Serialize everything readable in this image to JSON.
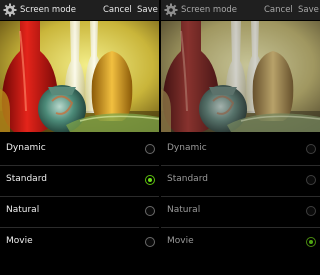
{
  "left": {
    "header": {
      "title": "Screen mode",
      "cancel_label": "Cancel",
      "save_label": "Save"
    },
    "modes": [
      {
        "label": "Dynamic",
        "selected": false
      },
      {
        "label": "Standard",
        "selected": true
      },
      {
        "label": "Natural",
        "selected": false
      },
      {
        "label": "Movie",
        "selected": false
      }
    ]
  },
  "right": {
    "header": {
      "title": "Screen mode",
      "cancel_label": "Cancel",
      "save_label": "Save"
    },
    "modes": [
      {
        "label": "Dynamic",
        "selected": false
      },
      {
        "label": "Standard",
        "selected": false
      },
      {
        "label": "Natural",
        "selected": false
      },
      {
        "label": "Movie",
        "selected": true
      }
    ]
  },
  "colors": {
    "accent": "#6ee01a",
    "topbar": "#1f1f1f",
    "background": "#000000"
  },
  "icons": {
    "header": "gear-icon",
    "option": "radio-button"
  }
}
